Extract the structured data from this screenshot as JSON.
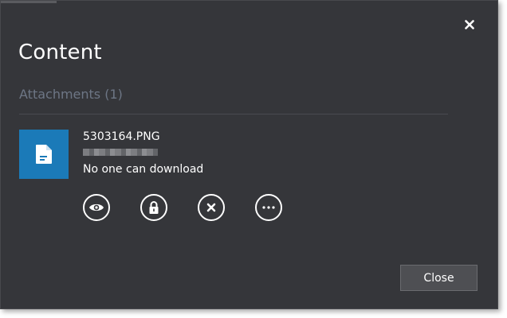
{
  "dialog": {
    "title": "Content",
    "close_icon": "close-icon"
  },
  "attachments": {
    "header": "Attachments (1)",
    "items": [
      {
        "file_name": "5303164.PNG",
        "permission": "No one can download",
        "icon": "document-icon",
        "tile_color": "#1b7ab8"
      }
    ],
    "actions": [
      {
        "name": "preview",
        "icon": "eye-icon"
      },
      {
        "name": "permissions",
        "icon": "lock-icon"
      },
      {
        "name": "remove",
        "icon": "remove-icon"
      },
      {
        "name": "more",
        "icon": "more-icon"
      }
    ]
  },
  "footer": {
    "close_label": "Close"
  },
  "colors": {
    "background": "#35363a",
    "section_header": "#6d7685",
    "accent": "#1b7ab8",
    "button_bg": "#4e4f53"
  }
}
